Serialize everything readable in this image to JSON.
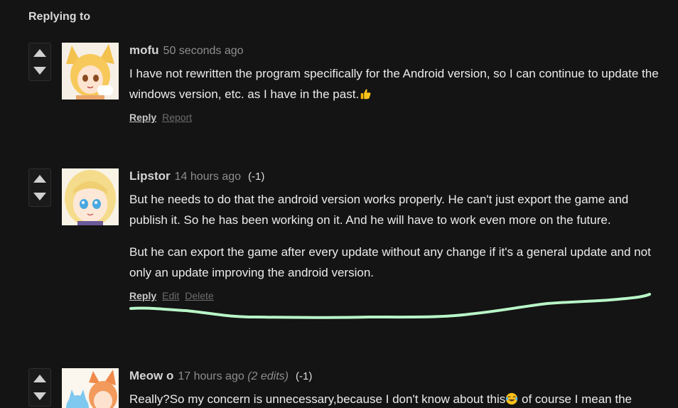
{
  "section_title": "Replying to",
  "comments": [
    {
      "author": "mofu",
      "time": "50 seconds ago",
      "edits": "",
      "score": "",
      "paragraphs": [
        "I have not rewritten the program specifically for the Android version, so I can continue to update the windows version, etc. as I have in the past."
      ],
      "trailing_emoji": "thumbs-up-icon",
      "actions": [
        "Reply",
        "Report"
      ]
    },
    {
      "author": "Lipstor",
      "time": "14 hours ago",
      "edits": "",
      "score": "(-1)",
      "paragraphs": [
        "But he needs to do that the android version works properly. He can't just export the game and publish it. So he has been working on it. And he will have to work even more on the future.",
        "But he can export the game after every update without any change if it's a general update and not only an update improving the android version."
      ],
      "actions": [
        "Reply",
        "Edit",
        "Delete"
      ]
    },
    {
      "author": "Meow o",
      "time": "17 hours ago",
      "edits": "(2 edits)",
      "score": "(-1)",
      "paragraph_before_emoji": "Really?So my concern is unnecessary,because I don't know about this",
      "inline_emoji": "tears-of-joy-icon",
      "paragraph_after_emoji": "of course I mean the"
    }
  ],
  "colors": {
    "background": "#141414",
    "highlight_stroke": "#b9f7c8"
  }
}
